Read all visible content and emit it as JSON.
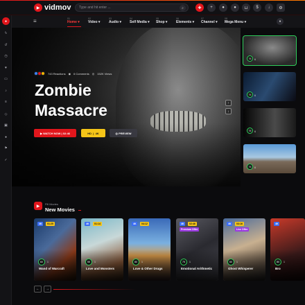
{
  "app": {
    "name": "vidmov",
    "accent": "#e1161c",
    "rating_color": "#2fcf5b"
  },
  "search": {
    "placeholder": "Type and hit enter ..."
  },
  "topbar_icons": [
    "add-icon",
    "bell-icon",
    "user-icon",
    "cart-icon",
    "dollar-icon",
    "download-icon",
    "settings-icon"
  ],
  "nav": {
    "items": [
      {
        "label": "Home",
        "num": "01"
      },
      {
        "label": "Video",
        "num": "02"
      },
      {
        "label": "Audio",
        "num": "03"
      },
      {
        "label": "Self Media",
        "num": "04"
      },
      {
        "label": "Shop",
        "num": "05"
      },
      {
        "label": "Elements",
        "num": "06"
      },
      {
        "label": "Channel",
        "num": "07"
      },
      {
        "label": "Mega Menu",
        "num": "08"
      }
    ]
  },
  "hero": {
    "reactions": "743 Reactions",
    "comments": "6 Comments",
    "views": "152K Views",
    "title_line1": "Zombie",
    "title_line2": "Massacre",
    "watch_label": "WATCH NOW",
    "duration": "02:46",
    "quality": "HD",
    "resolution": "4K",
    "preview_label": "PREVIEW"
  },
  "side_thumbs": [
    {
      "score": "75",
      "meta": "6"
    },
    {
      "score": "75",
      "meta": "6"
    },
    {
      "score": "75",
      "meta": "6"
    },
    {
      "score": "75",
      "meta": "6"
    }
  ],
  "section": {
    "subtitle": "Fill Movies",
    "title": "New Movies"
  },
  "movies": [
    {
      "title": "Wand of Warcraft",
      "chips": [
        "4K",
        "01:25"
      ],
      "score": "60",
      "meta": "1"
    },
    {
      "title": "Love and Monsters",
      "chips": [
        "4K",
        "01:14"
      ],
      "score": "55",
      "meta": "1"
    },
    {
      "title": "Love & Other Drugs",
      "chips": [
        "4K",
        "04:12"
      ],
      "score": "80",
      "meta": "1"
    },
    {
      "title": "Emotional Arithmetic",
      "chips": [
        "4K",
        "02:46"
      ],
      "tag": "Premium Offer",
      "score": "75",
      "meta": "1"
    },
    {
      "title": "Ghost Whisperer",
      "chips": [
        "4K",
        "03:16"
      ],
      "tag": "Live Offer",
      "score": "60",
      "meta": "1"
    },
    {
      "title": "Bro",
      "chips": [
        "4K"
      ],
      "score": "80",
      "meta": "1"
    }
  ]
}
